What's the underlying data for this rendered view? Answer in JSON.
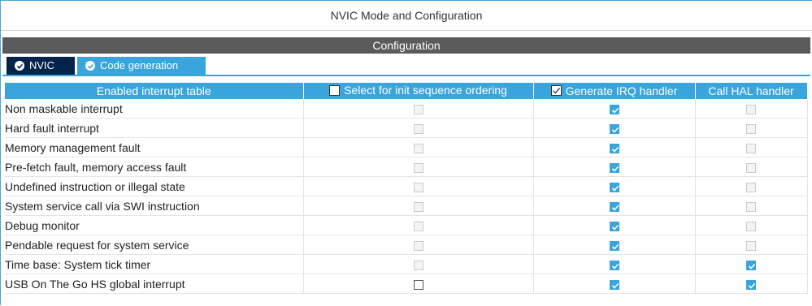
{
  "window": {
    "title": "NVIC Mode and Configuration"
  },
  "config_header": "Configuration",
  "tabs": [
    {
      "label": "NVIC",
      "icon": "check-circle-icon",
      "active": false
    },
    {
      "label": "Code generation",
      "icon": "check-circle-icon",
      "active": true
    }
  ],
  "table": {
    "columns": [
      {
        "label": "Enabled interrupt table",
        "has_checkbox": false
      },
      {
        "label": "Select for init sequence ordering",
        "has_checkbox": true,
        "checked": false
      },
      {
        "label": "Generate IRQ handler",
        "has_checkbox": true,
        "checked": true
      },
      {
        "label": "Call HAL handler",
        "has_checkbox": false
      }
    ],
    "rows": [
      {
        "name": "Non maskable interrupt",
        "init_order": "disabled",
        "irq_handler": "checked",
        "hal_handler": "disabled"
      },
      {
        "name": "Hard fault interrupt",
        "init_order": "disabled",
        "irq_handler": "checked",
        "hal_handler": "disabled"
      },
      {
        "name": "Memory management fault",
        "init_order": "disabled",
        "irq_handler": "checked",
        "hal_handler": "disabled"
      },
      {
        "name": "Pre-fetch fault, memory access fault",
        "init_order": "disabled",
        "irq_handler": "checked",
        "hal_handler": "disabled"
      },
      {
        "name": "Undefined instruction or illegal state",
        "init_order": "disabled",
        "irq_handler": "checked",
        "hal_handler": "disabled"
      },
      {
        "name": "System service call via SWI instruction",
        "init_order": "disabled",
        "irq_handler": "checked",
        "hal_handler": "disabled"
      },
      {
        "name": "Debug monitor",
        "init_order": "disabled",
        "irq_handler": "checked",
        "hal_handler": "disabled"
      },
      {
        "name": "Pendable request for system service",
        "init_order": "disabled",
        "irq_handler": "checked",
        "hal_handler": "disabled"
      },
      {
        "name": "Time base: System tick timer",
        "init_order": "disabled",
        "irq_handler": "checked",
        "hal_handler": "checked"
      },
      {
        "name": "USB On The Go HS global interrupt",
        "init_order": "unchecked",
        "irq_handler": "checked",
        "hal_handler": "checked"
      }
    ]
  },
  "colors": {
    "accent": "#39a5dc",
    "tab_dark": "#03234b",
    "header_gray": "#5b5b5b"
  }
}
